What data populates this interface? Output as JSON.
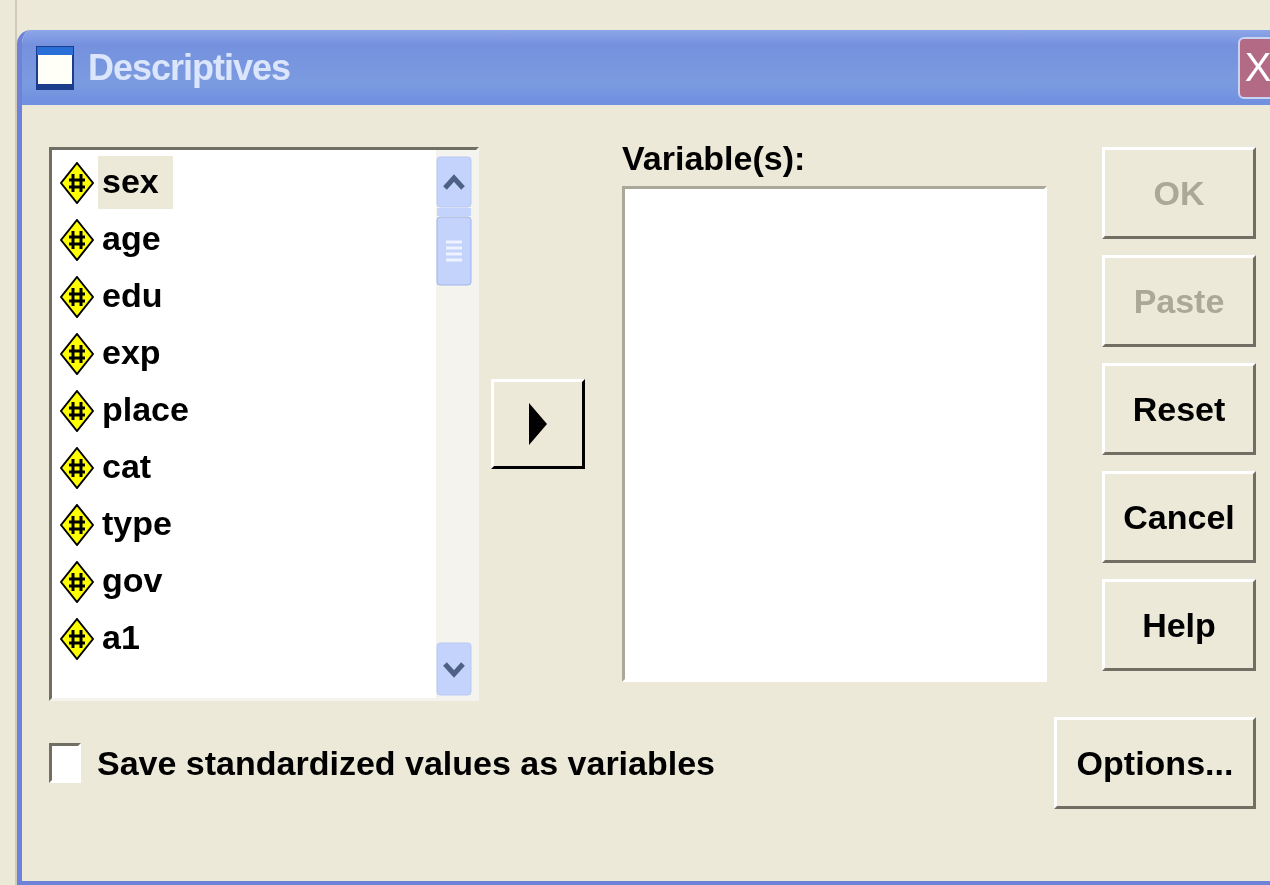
{
  "window": {
    "title": "Descriptives",
    "close": "X"
  },
  "variables": [
    {
      "name": "sex",
      "selected": true
    },
    {
      "name": "age",
      "selected": false
    },
    {
      "name": "edu",
      "selected": false
    },
    {
      "name": "exp",
      "selected": false
    },
    {
      "name": "place",
      "selected": false
    },
    {
      "name": "cat",
      "selected": false
    },
    {
      "name": "type",
      "selected": false
    },
    {
      "name": "gov",
      "selected": false
    },
    {
      "name": "a1",
      "selected": false
    }
  ],
  "target": {
    "label": "Variable(s):"
  },
  "buttons": [
    {
      "label": "OK",
      "disabled": true
    },
    {
      "label": "Paste",
      "disabled": true
    },
    {
      "label": "Reset",
      "disabled": false
    },
    {
      "label": "Cancel",
      "disabled": false
    },
    {
      "label": "Help",
      "disabled": false
    }
  ],
  "checkbox": {
    "label": "Save standardized values as variables",
    "checked": false
  },
  "options_button": {
    "label": "Options..."
  }
}
